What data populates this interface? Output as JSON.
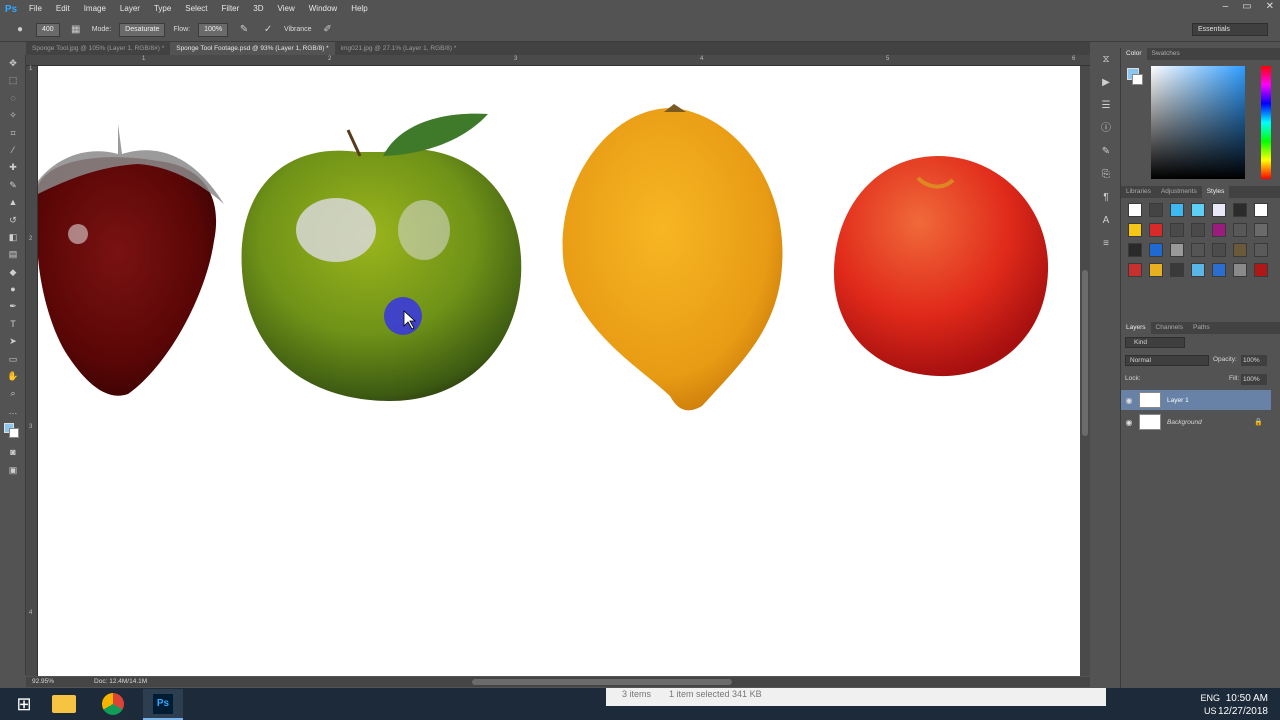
{
  "app": {
    "logo": "Ps"
  },
  "menu": [
    "File",
    "Edit",
    "Image",
    "Layer",
    "Type",
    "Select",
    "Filter",
    "3D",
    "View",
    "Window",
    "Help"
  ],
  "window_controls": [
    "–",
    "▭",
    "✕"
  ],
  "options": {
    "brush_size": "400",
    "mode_label": "Mode:",
    "mode_value": "Desaturate",
    "flow_label": "Flow:",
    "flow_value": "100%",
    "vibrance_label": "Vibrance",
    "workspace": "Essentials"
  },
  "tabs": [
    {
      "label": "Sponge Tool.jpg @ 105% (Layer 1, RGB/8#) *",
      "active": false
    },
    {
      "label": "Sponge Tool Footage.psd @ 93% (Layer 1, RGB/8) *",
      "active": true
    },
    {
      "label": "img021.jpg @ 27.1% (Layer 1, RGB/8) *",
      "active": false
    }
  ],
  "ruler_top": [
    "1",
    "2",
    "3",
    "4",
    "5",
    "6"
  ],
  "ruler_left": [
    "1",
    "2",
    "3",
    "4"
  ],
  "status": {
    "zoom": "92.95%",
    "doc": "Doc: 12.4M/14.1M"
  },
  "color_panel": {
    "tabs": [
      "Color",
      "Swatches"
    ],
    "fg_color": "#8ac6f0",
    "bg_color": "#ffffff"
  },
  "styles_panel": {
    "tabs": [
      "Libraries",
      "Adjustments",
      "Styles"
    ],
    "swatches": [
      "#ffffff",
      "#444444",
      "#3db8f0",
      "#5ed0f5",
      "#e8e8f8",
      "#2b2b2b",
      "#ffffff",
      "#f5c518",
      "#d92a2a",
      "#4a4a4a",
      "#4a4a4a",
      "#9b1c7e",
      "#585858",
      "#6a6a6a",
      "#2a2a2a",
      "#1f6ad0",
      "#999999",
      "#555555",
      "#4c4c4c",
      "#6b5a3a",
      "#5a5a5a",
      "#c83030",
      "#e8b020",
      "#3a3a3a",
      "#5bb6e8",
      "#2a6fd0",
      "#8a8a8a",
      "#b01818"
    ]
  },
  "layers_panel": {
    "tabs": [
      "Layers",
      "Channels",
      "Paths"
    ],
    "kind_label": "Kind",
    "blend_mode": "Normal",
    "opacity_label": "Opacity:",
    "opacity_value": "100%",
    "lock_label": "Lock:",
    "fill_label": "Fill:",
    "fill_value": "100%",
    "layers": [
      {
        "name": "Layer 1",
        "selected": true
      },
      {
        "name": "Background",
        "selected": false,
        "locked": true
      }
    ]
  },
  "explorer_status": {
    "items": "3 items",
    "selected": "1 item selected  341 KB"
  },
  "taskbar": {
    "lang_top": "ENG",
    "lang_bottom": "US",
    "time": "10:50 AM",
    "date": "12/27/2018"
  }
}
